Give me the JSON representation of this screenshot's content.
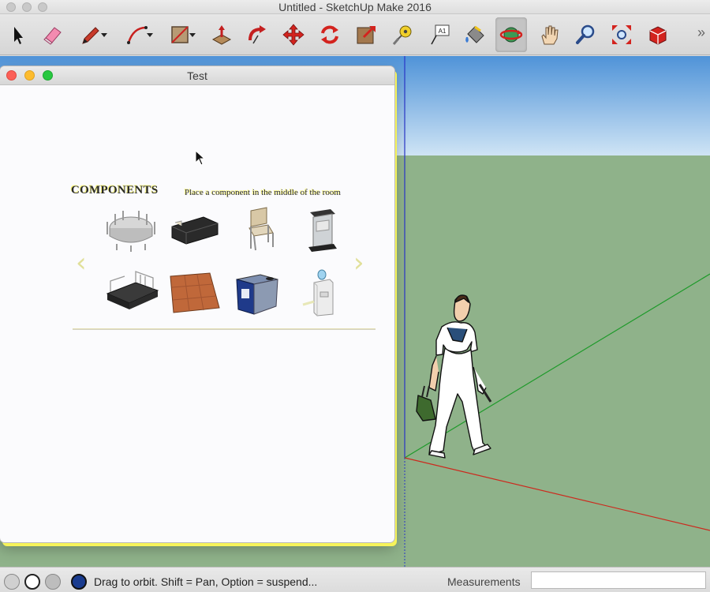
{
  "window": {
    "title": "Untitled - SketchUp Make 2016"
  },
  "toolbar": {
    "tools": [
      {
        "name": "select-tool-icon"
      },
      {
        "name": "eraser-tool-icon"
      },
      {
        "name": "line-tool-icon"
      },
      {
        "name": "arc-tool-icon"
      },
      {
        "name": "shape-tool-icon"
      },
      {
        "name": "push-pull-tool-icon"
      },
      {
        "name": "follow-me-tool-icon"
      },
      {
        "name": "move-tool-icon"
      },
      {
        "name": "rotate-tool-icon"
      },
      {
        "name": "scale-tool-icon"
      },
      {
        "name": "tape-measure-tool-icon"
      },
      {
        "name": "text-tool-icon"
      },
      {
        "name": "paint-bucket-tool-icon"
      },
      {
        "name": "orbit-tool-icon",
        "active": true
      },
      {
        "name": "pan-tool-icon"
      },
      {
        "name": "zoom-tool-icon"
      },
      {
        "name": "zoom-extents-tool-icon"
      },
      {
        "name": "warehouse-tool-icon"
      }
    ],
    "text_tool_badge": "A1",
    "overflow_label": "»"
  },
  "dialog": {
    "title": "Test",
    "heading": "COMPONENTS",
    "instruction": "Place a component in the middle of the room",
    "nav_prev": "‹",
    "nav_next": "›",
    "components": [
      {
        "name": "round-table-with-chairs"
      },
      {
        "name": "black-sofa"
      },
      {
        "name": "metal-chair"
      },
      {
        "name": "podium-lectern"
      },
      {
        "name": "stage-platform"
      },
      {
        "name": "wooden-floor-tile"
      },
      {
        "name": "blue-recycling-bin"
      },
      {
        "name": "water-cooler"
      }
    ]
  },
  "statusbar": {
    "message": "Drag to orbit.  Shift = Pan, Option = suspend...",
    "measurements_label": "Measurements",
    "measurements_value": ""
  },
  "colors": {
    "sky_top": "#4f93d8",
    "sky_bottom": "#cde3f5",
    "ground": "#8fb28a",
    "axis_red": "#cc2a1e",
    "axis_green": "#1e9a2a",
    "axis_blue": "#2a36c8",
    "highlight_yellow": "#f6f35a"
  }
}
